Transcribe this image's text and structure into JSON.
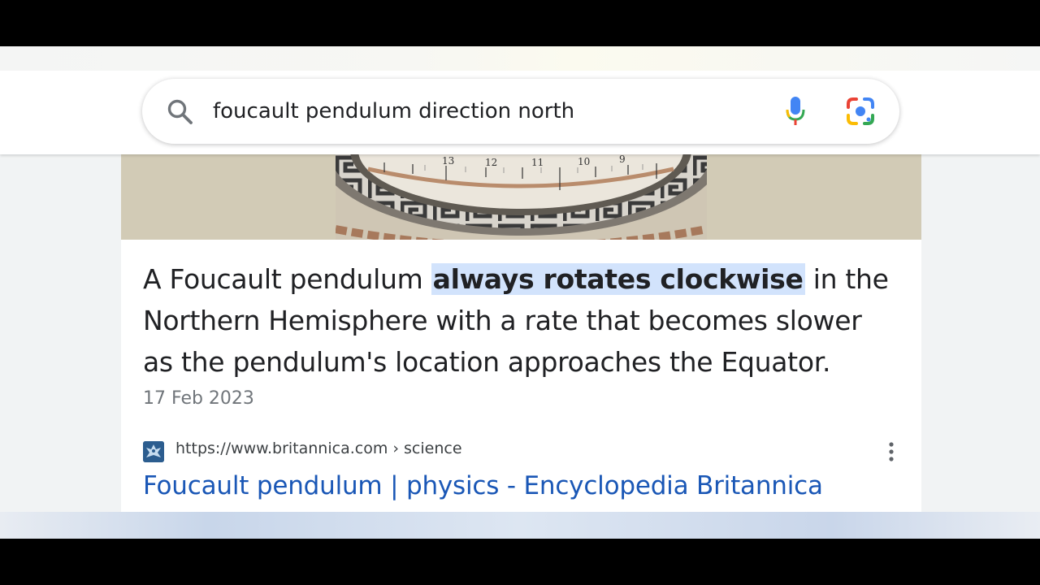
{
  "search": {
    "query": "foucault pendulum direction north",
    "search_icon": "search-icon",
    "mic_icon": "mic-icon",
    "lens_icon": "google-lens-icon"
  },
  "result": {
    "snippet_before": "A Foucault pendulum ",
    "snippet_highlight": "always rotates clockwise",
    "snippet_after": " in the Northern Hemisphere with a rate that becomes slower as the pendulum's location approaches the Equator.",
    "date": "17 Feb 2023",
    "source_url": "https://www.britannica.com › science",
    "title": "Foucault pendulum | physics - Encyclopedia Britannica",
    "more_icon": "more-vert-icon",
    "favicon": "britannica-favicon"
  },
  "image": {
    "dial_numbers": [
      "13",
      "12",
      "11",
      "10",
      "9"
    ]
  },
  "colors": {
    "highlight": "#d2e3fc",
    "link": "#1a57b6",
    "image_background": "#d2cbb6"
  }
}
